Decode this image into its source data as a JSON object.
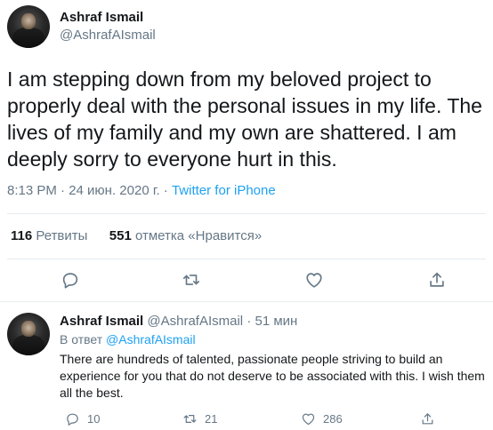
{
  "tweet": {
    "author_name": "Ashraf Ismail",
    "author_handle": "@AshrafAIsmail",
    "text": "I am stepping down from my beloved project to properly deal with the personal issues in my life. The lives of my family and my own are shattered. I am deeply sorry to everyone hurt in this.",
    "time": "8:13 PM · 24 июн. 2020 г. · ",
    "source": "Twitter for iPhone",
    "retweets_count": "116",
    "retweets_label": "Ретвиты",
    "likes_count": "551",
    "likes_label": "отметка «Нравится»"
  },
  "reply": {
    "author_name": "Ashraf Ismail",
    "author_handle": "@AshrafAIsmail",
    "time": "· 51 мин",
    "reply_to_prefix": "В ответ",
    "reply_to_handle": "@AshrafAIsmail",
    "text": "There are hundreds of talented, passionate people striving to build an experience for you that do not deserve to be associated with this. I wish them all the best.",
    "reply_count": "10",
    "retweet_count": "21",
    "like_count": "286"
  },
  "icons": {
    "reply": "reply-icon",
    "retweet": "retweet-icon",
    "like": "heart-icon",
    "share": "share-icon"
  },
  "colors": {
    "accent": "#1da1f2",
    "secondary_text": "#657786",
    "primary_text": "#14171a",
    "divider": "#e6ecf0"
  }
}
